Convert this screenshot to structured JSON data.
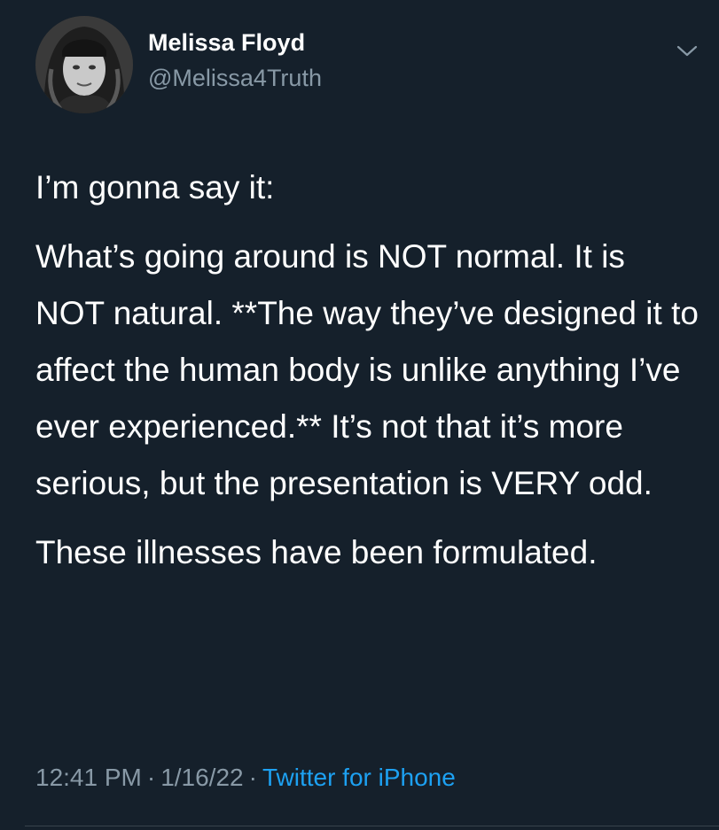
{
  "author": {
    "name": "Melissa Floyd",
    "handle": "@Melissa4Truth"
  },
  "tweet": {
    "paragraphs": [
      "I’m gonna say it:",
      "What’s going around is NOT normal. It is NOT natural. **The way they’ve designed it to affect the human body is unlike anything I’ve ever experienced.** It’s not that it’s more serious, but the presentation is VERY odd.",
      "These illnesses have been formulated."
    ]
  },
  "meta": {
    "time": "12:41 PM",
    "separator": "·",
    "date": "1/16/22",
    "source": "Twitter for iPhone"
  },
  "icons": {
    "more": "chevron-down-icon"
  },
  "colors": {
    "background": "#15202b",
    "text": "#ffffff",
    "secondary_text": "#8899a6",
    "link": "#1da1f2"
  }
}
